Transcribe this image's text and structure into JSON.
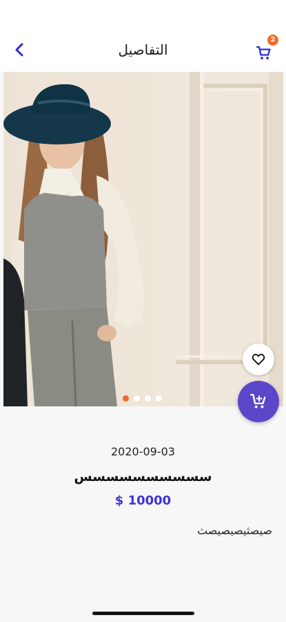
{
  "header": {
    "title": "التفاصيل",
    "cart_count": "2",
    "back_icon": "chevron-left-icon",
    "cart_icon": "shopping-cart-icon"
  },
  "product": {
    "date": "2020-09-03",
    "name": "سسسسسسسسسس",
    "price": "$ 10000",
    "description": "صيصثيصيصيصث",
    "image_total": 4,
    "image_active_index": 0
  },
  "actions": {
    "wishlist_icon": "heart-outline-icon",
    "add_to_cart_icon": "cart-plus-icon"
  },
  "colors": {
    "accent": "#3d33d6",
    "fab": "#5b47c9",
    "badge": "#f26a2d",
    "active_dot": "#f26a2d"
  }
}
